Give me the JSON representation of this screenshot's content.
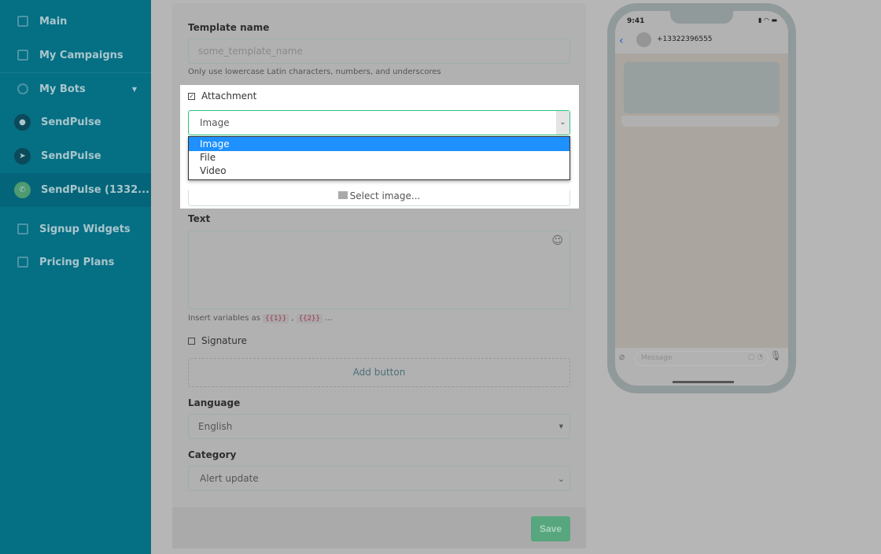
{
  "sidebar": {
    "items": [
      {
        "label": "Main",
        "icon": "sliders-icon"
      },
      {
        "label": "My Campaigns",
        "icon": "campaign-icon"
      },
      {
        "label": "My Bots",
        "icon": "bot-icon"
      },
      {
        "label": "SendPulse",
        "icon": "messenger-icon"
      },
      {
        "label": "SendPulse",
        "icon": "telegram-icon"
      },
      {
        "label": "SendPulse (1332...",
        "icon": "whatsapp-icon"
      },
      {
        "label": "Signup Widgets",
        "icon": "widget-icon"
      },
      {
        "label": "Pricing Plans",
        "icon": "wallet-icon"
      }
    ]
  },
  "form": {
    "template_name_label": "Template name",
    "template_name_placeholder": "some_template_name",
    "template_name_hint": "Only use lowercase Latin characters, numbers, and underscores",
    "attachment_label": "Attachment",
    "attachment_checked": true,
    "attachment_type": "Image",
    "attachment_options": [
      "Image",
      "File",
      "Video"
    ],
    "select_image": "Select image...",
    "text_label": "Text",
    "hint_prefix": "Insert variables as",
    "var1": "{{1}}",
    "var2": "{{2}}",
    "hint_suffix": "...",
    "signature_label": "Signature",
    "add_button": "Add button",
    "language_label": "Language",
    "language_value": "English",
    "category_label": "Category",
    "category_value": "Alert update",
    "save": "Save"
  },
  "phone": {
    "time": "9:41",
    "contact": "+13322396555",
    "message_placeholder": "Message"
  }
}
